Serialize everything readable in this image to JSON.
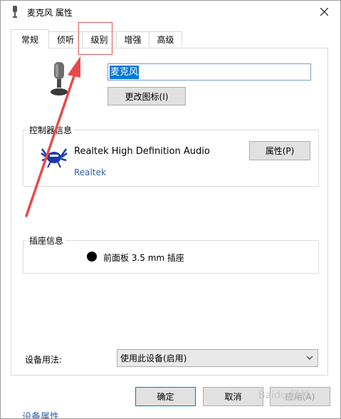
{
  "window": {
    "title": "麦克风 属性"
  },
  "tabs": [
    {
      "label": "常规",
      "active": true
    },
    {
      "label": "侦听",
      "active": false
    },
    {
      "label": "级别",
      "active": false
    },
    {
      "label": "增强",
      "active": false
    },
    {
      "label": "高级",
      "active": false
    }
  ],
  "device": {
    "name_value": "麦克风",
    "change_icon_label": "更改图标(I)"
  },
  "controller": {
    "legend": "控制器信息",
    "name": "Realtek High Definition Audio",
    "vendor_link": "Realtek",
    "properties_label": "属性(P)"
  },
  "jack": {
    "legend": "插座信息",
    "label": "前面板 3.5 mm 插座",
    "dot_color": "#000000"
  },
  "usage": {
    "label": "设备用法:",
    "selected": "使用此设备(启用)"
  },
  "footer": {
    "ok_label": "确定",
    "cancel_label": "取消",
    "apply_label": "应用(A)",
    "cut_text": "设备属性"
  },
  "watermark": {
    "text": "Baidu 经验"
  },
  "annotation": {
    "color": "#e84a4a"
  },
  "colors": {
    "selection": "#0078d7",
    "link": "#2f5fa8",
    "button_face": "#e1e1e1"
  }
}
